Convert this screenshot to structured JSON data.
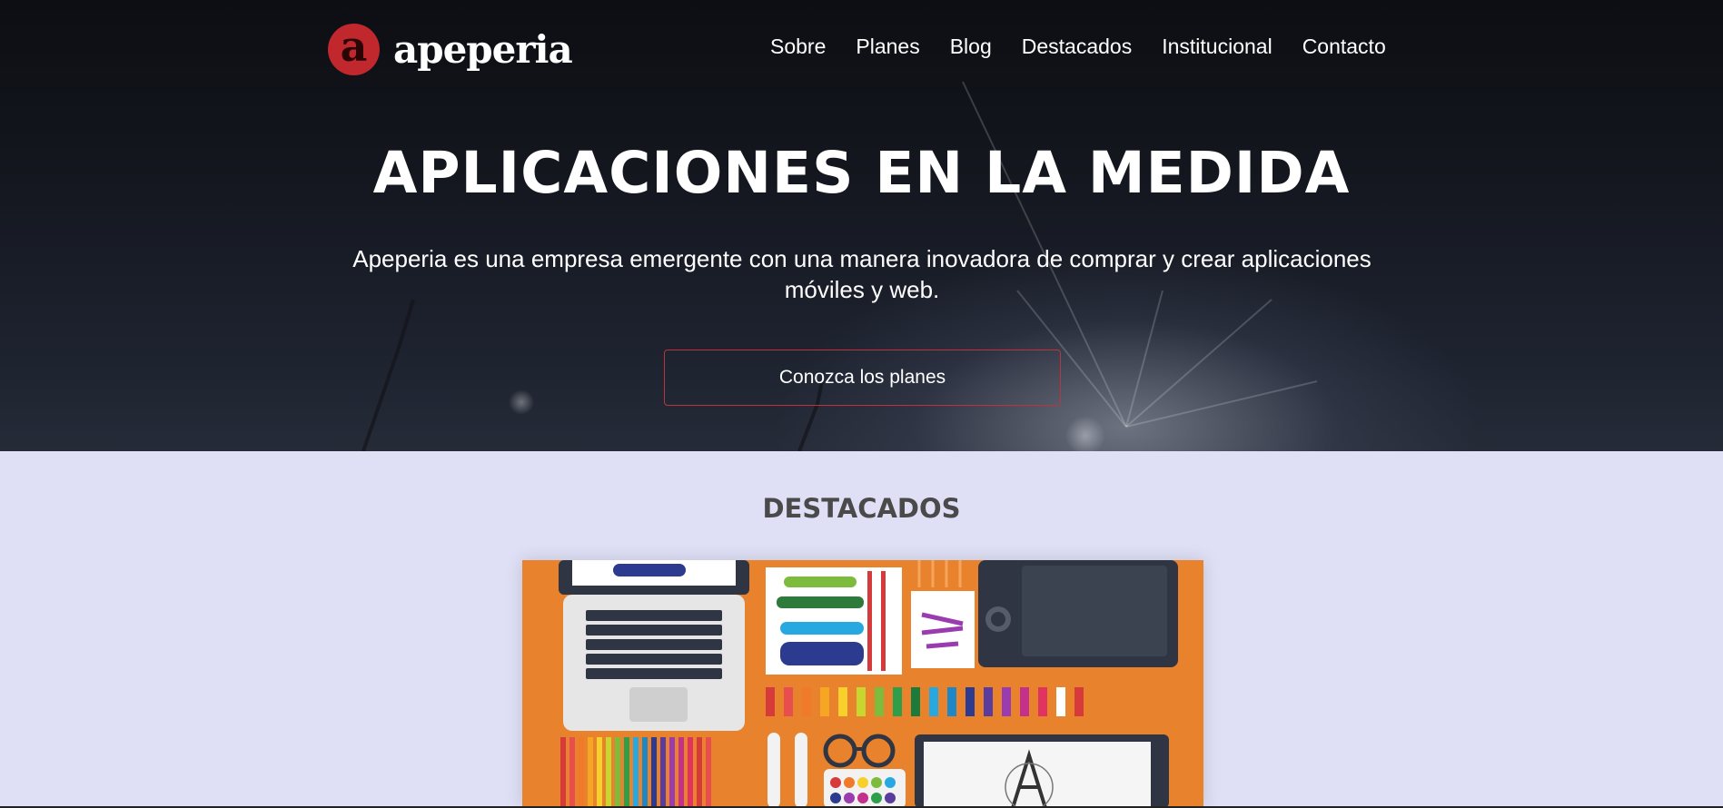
{
  "header": {
    "logo_letter": "a",
    "logo_text": "apeperia",
    "nav": [
      "Sobre",
      "Planes",
      "Blog",
      "Destacados",
      "Institucional",
      "Contacto"
    ]
  },
  "hero": {
    "title": "APLICACIONES EN LA MEDIDA",
    "subtitle": "Apeperia es una empresa emergente con una manera inovadora de comprar y crear aplicaciones móviles y web.",
    "cta_label": "Conozca los planes"
  },
  "featured": {
    "title": "DESTACADOS",
    "image_icon": "designer-desk-illustration"
  },
  "colors": {
    "brand_red": "#c0282d",
    "featured_bg": "#dfe0f6",
    "illustration_orange": "#e8822d"
  }
}
